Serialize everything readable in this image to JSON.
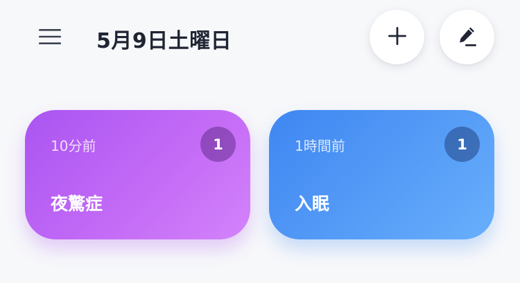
{
  "header": {
    "date_title": "5月9日土曜日",
    "menu_icon": "hamburger-menu-icon",
    "add_icon": "plus-icon",
    "edit_icon": "pencil-icon"
  },
  "colors": {
    "title_text": "#1f2533",
    "background": "#f7f8fa",
    "card_purple": "#b85ff5",
    "card_blue": "#4f95f5"
  },
  "cards": [
    {
      "time": "10分前",
      "count": "1",
      "title": "夜驚症"
    },
    {
      "time": "1時間前",
      "count": "1",
      "title": "入眠"
    }
  ]
}
